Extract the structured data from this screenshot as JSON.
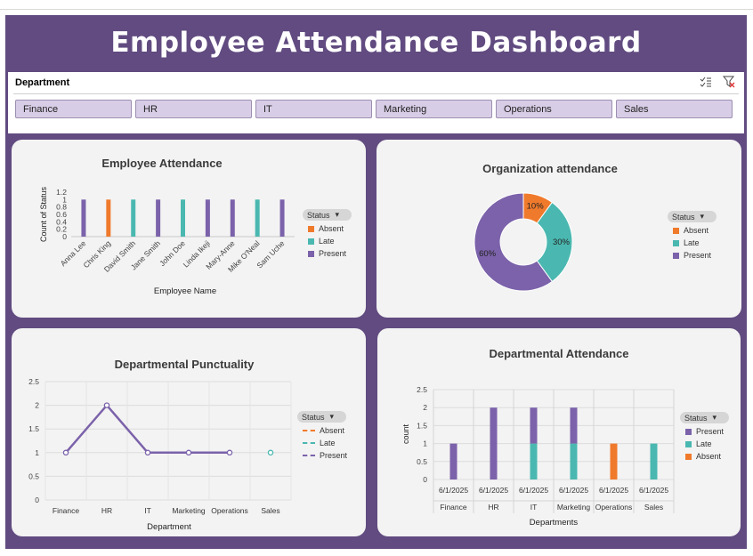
{
  "title": "Employee Attendance Dashboard",
  "slicer": {
    "header": "Department",
    "items": [
      "Finance",
      "HR",
      "IT",
      "Marketing",
      "Operations",
      "Sales"
    ]
  },
  "colors": {
    "present": "#7b62aa",
    "late": "#4ab8b0",
    "absent": "#f07a2c",
    "bg": "#614b80"
  },
  "legend_header": "Status",
  "emp_chart": {
    "title": "Employee Attendance",
    "xlabel": "Employee Name",
    "ylabel": "Count of Status",
    "legend": [
      "Absent",
      "Late",
      "Present"
    ]
  },
  "org_chart": {
    "title": "Organization attendance",
    "legend": [
      "Absent",
      "Late",
      "Present"
    ],
    "labels": [
      "10%",
      "30%",
      "60%"
    ]
  },
  "punct_chart": {
    "title": "Departmental Punctuality",
    "xlabel": "Department",
    "legend": [
      "Absent",
      "Late",
      "Present"
    ]
  },
  "dept_chart": {
    "title": "Departmental Attendance",
    "xlabel": "Departments",
    "ylabel": "count",
    "legend": [
      "Present",
      "Late",
      "Absent"
    ],
    "date_label": "6/1/2025"
  },
  "chart_data": [
    {
      "type": "bar",
      "title": "Employee Attendance",
      "xlabel": "Employee Name",
      "ylabel": "Count of Status",
      "categories": [
        "Anna Lee",
        "Chris King",
        "David Smith",
        "Jane Smith",
        "John Doe",
        "Linda Ikeji",
        "Mary-Anne",
        "Mike O'Neal",
        "Sam Uche"
      ],
      "status": [
        "Present",
        "Absent",
        "Late",
        "Present",
        "Late",
        "Present",
        "Present",
        "Late",
        "Present"
      ],
      "values": [
        1,
        1,
        1,
        1,
        1,
        1,
        1,
        1,
        1
      ],
      "yticks": [
        "0",
        "0.2",
        "0.4",
        "0.6",
        "0.8",
        "1",
        "1.2"
      ],
      "ylim": [
        0,
        1.2
      ]
    },
    {
      "type": "pie",
      "title": "Organization attendance",
      "slices": [
        {
          "name": "Absent",
          "value": 10,
          "label": "10%"
        },
        {
          "name": "Late",
          "value": 30,
          "label": "30%"
        },
        {
          "name": "Present",
          "value": 60,
          "label": "60%"
        }
      ]
    },
    {
      "type": "line",
      "title": "Departmental Punctuality",
      "xlabel": "Department",
      "categories": [
        "Finance",
        "HR",
        "IT",
        "Marketing",
        "Operations",
        "Sales"
      ],
      "yticks": [
        "0",
        "0.5",
        "1",
        "1.5",
        "2",
        "2.5"
      ],
      "ylim": [
        0,
        2.5
      ],
      "series": [
        {
          "name": "Present",
          "values": [
            1,
            2,
            1,
            1,
            1,
            null
          ]
        },
        {
          "name": "Late",
          "values": [
            null,
            null,
            null,
            null,
            null,
            1
          ]
        }
      ]
    },
    {
      "type": "bar",
      "title": "Departmental Attendance",
      "xlabel": "Departments",
      "ylabel": "count",
      "categories": [
        "Finance",
        "HR",
        "IT",
        "Marketing",
        "Operations",
        "Sales"
      ],
      "dates": [
        "6/1/2025",
        "6/1/2025",
        "6/1/2025",
        "6/1/2025",
        "6/1/2025",
        "6/1/2025"
      ],
      "yticks": [
        "0",
        "0.5",
        "1",
        "1.5",
        "2",
        "2.5"
      ],
      "ylim": [
        0,
        2.5
      ],
      "series": [
        {
          "name": "Late",
          "values": [
            0,
            0,
            1,
            1,
            0,
            1
          ]
        },
        {
          "name": "Present",
          "values": [
            1,
            2,
            1,
            1,
            0,
            0
          ]
        },
        {
          "name": "Absent",
          "values": [
            0,
            0,
            0,
            0,
            1,
            0
          ]
        }
      ]
    }
  ]
}
